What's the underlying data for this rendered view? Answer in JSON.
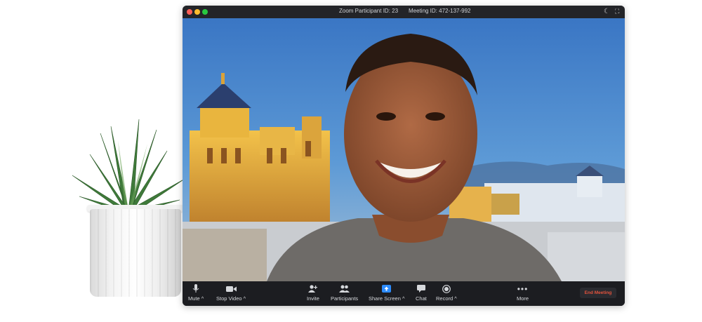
{
  "window": {
    "participant_id": "Zoom Participant ID: 23",
    "meeting_id": "Meeting ID: 472-137-992"
  },
  "toolbar": {
    "mute": "Mute",
    "stop_video": "Stop Video",
    "invite": "Invite",
    "participants": "Participants",
    "share_screen": "Share Screen",
    "chat": "Chat",
    "record": "Record",
    "more": "More",
    "end_meeting": "End Meeting"
  },
  "colors": {
    "end_meeting_text": "#e5533d",
    "share_screen_accent": "#2d8cff",
    "toolbar_bg": "#1c1d21"
  }
}
